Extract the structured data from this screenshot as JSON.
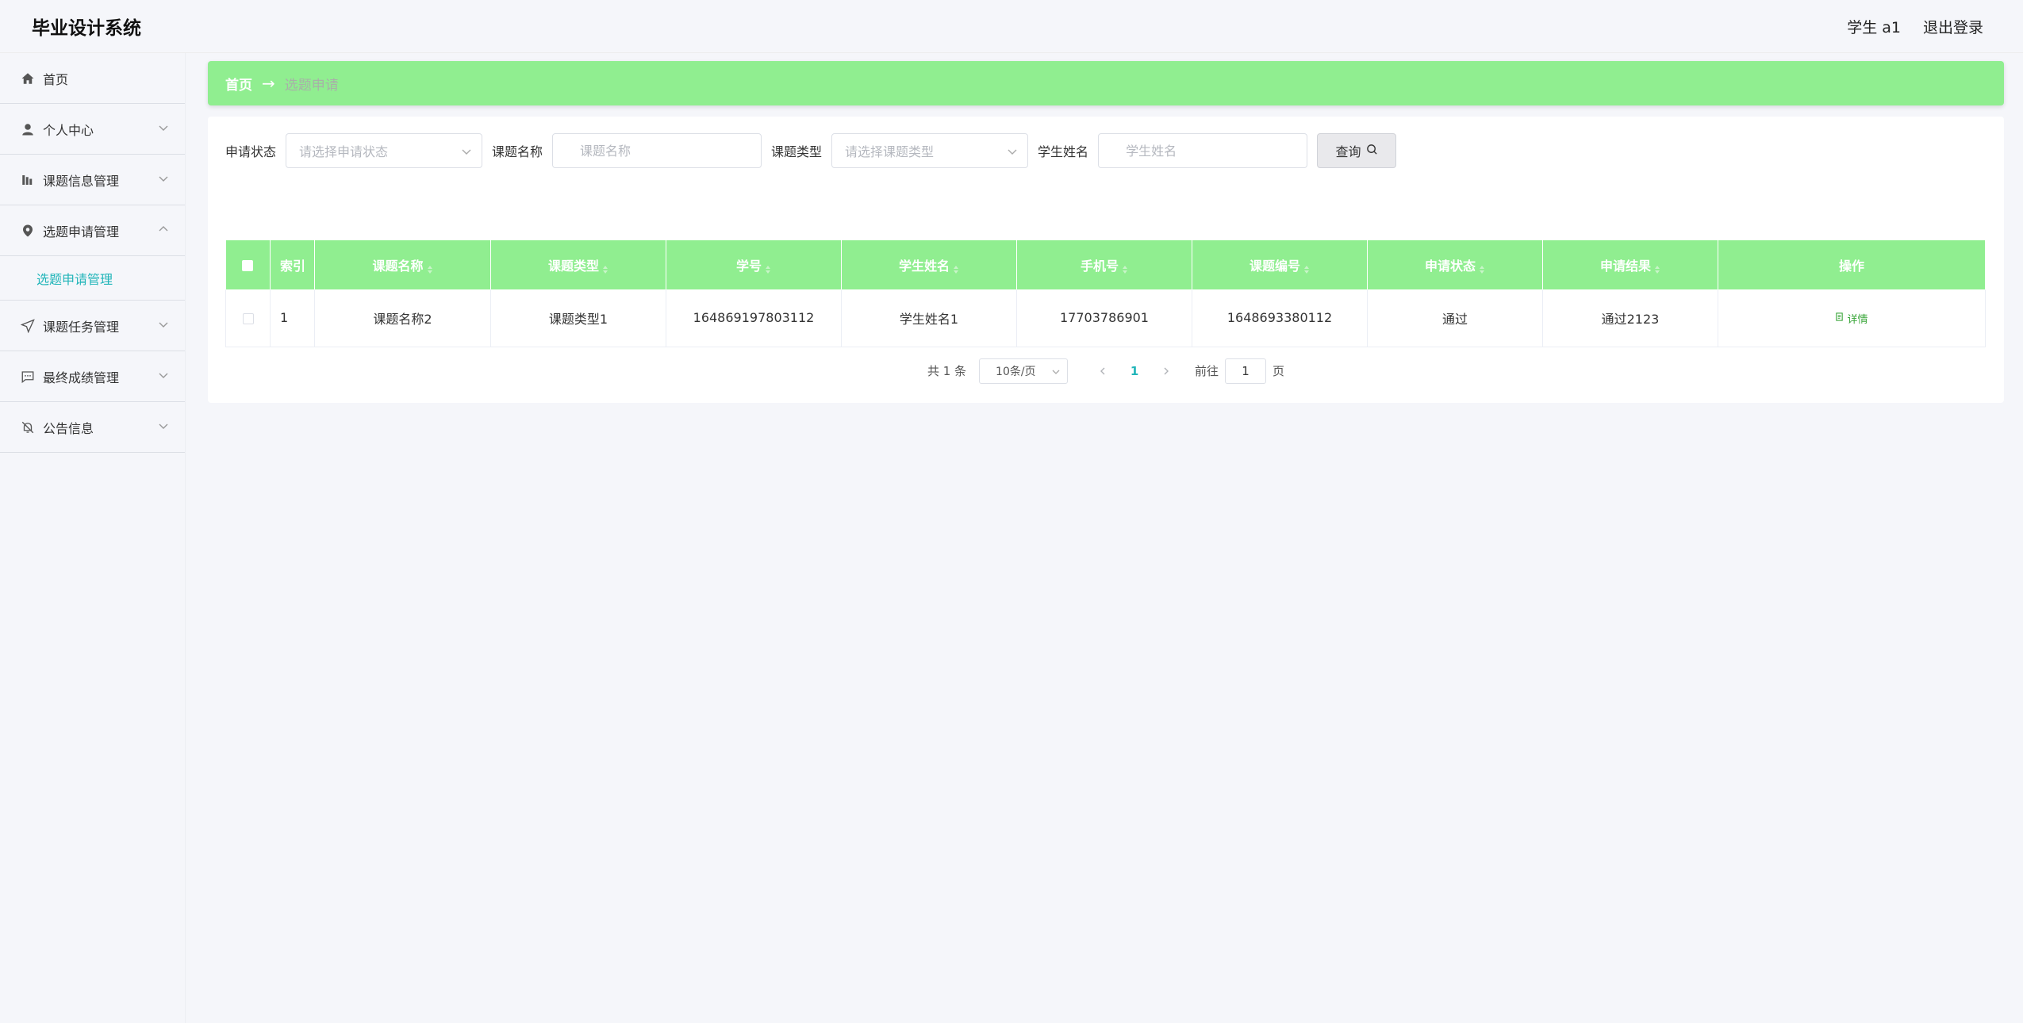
{
  "header": {
    "app_title": "毕业设计系统",
    "user_label": "学生 a1",
    "logout_label": "退出登录"
  },
  "sidebar": {
    "items": [
      {
        "label": "首页",
        "icon": "home-icon"
      },
      {
        "label": "个人中心",
        "icon": "user-icon"
      },
      {
        "label": "课题信息管理",
        "icon": "chart-icon"
      },
      {
        "label": "选题申请管理",
        "icon": "pin-icon",
        "expanded": true
      },
      {
        "label": "课题任务管理",
        "icon": "send-icon"
      },
      {
        "label": "最终成绩管理",
        "icon": "message-icon"
      },
      {
        "label": "公告信息",
        "icon": "bell-off-icon"
      }
    ],
    "submenu": {
      "label": "选题申请管理"
    }
  },
  "breadcrumb": {
    "home": "首页",
    "separator": "→",
    "current": "选题申请"
  },
  "search": {
    "status_label": "申请状态",
    "status_placeholder": "请选择申请状态",
    "topic_name_label": "课题名称",
    "topic_name_placeholder": "课题名称",
    "topic_type_label": "课题类型",
    "topic_type_placeholder": "请选择课题类型",
    "student_name_label": "学生姓名",
    "student_name_placeholder": "学生姓名",
    "query_label": "查询"
  },
  "table": {
    "columns": [
      "索引",
      "课题名称",
      "课题类型",
      "学号",
      "学生姓名",
      "手机号",
      "课题编号",
      "申请状态",
      "申请结果",
      "操作"
    ],
    "rows": [
      {
        "index": "1",
        "topic_name": "课题名称2",
        "topic_type": "课题类型1",
        "student_no": "164869197803112",
        "student_name": "学生姓名1",
        "phone": "17703786901",
        "topic_no": "1648693380112",
        "status": "通过",
        "result": "通过2123",
        "action": "详情"
      }
    ]
  },
  "pagination": {
    "total": "共 1 条",
    "page_size": "10条/页",
    "current_page": "1",
    "goto_prefix": "前往",
    "goto_value": "1",
    "goto_suffix": "页"
  },
  "colors": {
    "accent_green": "#90ee90",
    "active_teal": "#21b5b9",
    "link_green": "#3aa63a"
  }
}
